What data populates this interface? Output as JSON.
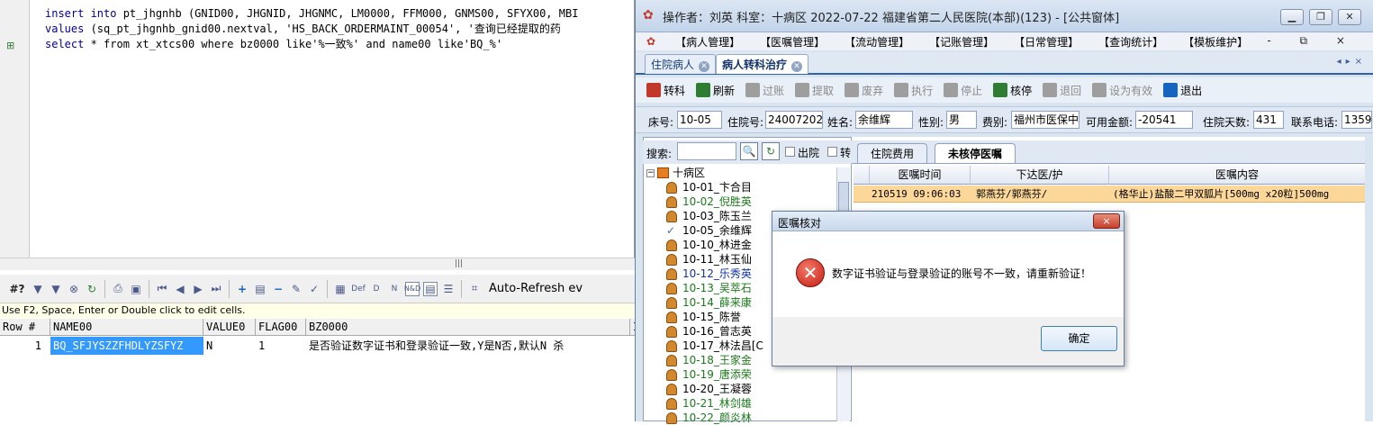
{
  "sql_editor": {
    "lines": [
      {
        "kw1": "insert into",
        "rest": " pt_jhgnhb (GNID00, JHGNID, JHGNMC, LM0000, FFM000, GNMS00, SFYX00, MBI"
      },
      {
        "kw1": "values",
        "rest": " (sq_pt_jhgnhb_gnid00.nextval, 'HS_BACK_ORDERMAINT_00054', '查询已经提取的药"
      },
      {
        "kw1": "select",
        "rest": " * from xt_xtcs00 where bz0000 like'%一致%' and name00 like'BQ_%'"
      }
    ]
  },
  "grid": {
    "auto_refresh": "Auto-Refresh ev",
    "hint": "Use F2, Space, Enter or Double click to edit cells.",
    "headers": [
      "Row #",
      "NAME00",
      "VALUE0",
      "FLAG00",
      "BZ0000",
      "I"
    ],
    "row": {
      "num": "1",
      "name00": "BQ_SFJYSZZFHDLYZSFYZ",
      "value0": "N",
      "flag00": "1",
      "bz0000": "是否验证数字证书和登录验证一致,Y是N否,默认N 杀"
    }
  },
  "app": {
    "title": "操作者：刘英  科室：十病区  2022-07-22  福建省第二人民医院(本部)(123) - [公共窗体]",
    "menus": [
      "【病人管理】",
      "【医嘱管理】",
      "【流动管理】",
      "【记账管理】",
      "【日常管理】",
      "【查询统计】",
      "【模板维护】"
    ],
    "menu_icons": "- ⧉ ×",
    "tabs": [
      "住院病人",
      "病人转科治疗"
    ],
    "actions": [
      {
        "label": "转科",
        "icon": "transfer-icon",
        "color": "#c0392b",
        "enabled": true
      },
      {
        "label": "刷新",
        "icon": "refresh-icon",
        "color": "#2e7d32",
        "enabled": true
      },
      {
        "label": "过账",
        "icon": "post-icon",
        "color": "#9e9e9e",
        "enabled": false
      },
      {
        "label": "提取",
        "icon": "extract-icon",
        "color": "#9e9e9e",
        "enabled": false
      },
      {
        "label": "废弃",
        "icon": "trash-icon",
        "color": "#9e9e9e",
        "enabled": false
      },
      {
        "label": "执行",
        "icon": "execute-icon",
        "color": "#9e9e9e",
        "enabled": false
      },
      {
        "label": "停止",
        "icon": "stop-icon",
        "color": "#9e9e9e",
        "enabled": false
      },
      {
        "label": "核停",
        "icon": "verify-stop-icon",
        "color": "#2e7d32",
        "enabled": true
      },
      {
        "label": "退回",
        "icon": "return-icon",
        "color": "#9e9e9e",
        "enabled": false
      },
      {
        "label": "设为有效",
        "icon": "set-valid-icon",
        "color": "#9e9e9e",
        "enabled": false
      },
      {
        "label": "退出",
        "icon": "exit-icon",
        "color": "#1565c0",
        "enabled": true
      }
    ],
    "info": {
      "bed_label": "床号:",
      "bed": "10-05",
      "admit_label": "住院号:",
      "admit": "24007202",
      "name_label": "姓名:",
      "name": "余维辉",
      "sex_label": "性别:",
      "sex": "男",
      "fee_label": "费别:",
      "fee": "福州市医保中",
      "balance_label": "可用金额:",
      "balance": "-20541",
      "days_label": "住院天数:",
      "days": "431",
      "phone_label": "联系电话:",
      "phone": "1359"
    },
    "search_label": "搜索:",
    "discharge_label": "出院",
    "transfer_label": "转",
    "subtabs": [
      "住院费用",
      "未核停医嘱"
    ],
    "order_headers": [
      "医嘱时间",
      "下达医/护",
      "医嘱内容"
    ],
    "order_row": {
      "time": "210519 09:06:03",
      "doctor": "郭燕芬/郭燕芬/",
      "content": "(格华止)盐酸二甲双胍片[500mg x20粒]500mg"
    },
    "tree": {
      "root": "十病区",
      "patients": [
        {
          "label": "10-01_卞合目",
          "style": "normal"
        },
        {
          "label": "10-02_倪胜英",
          "style": "green"
        },
        {
          "label": "10-03_陈玉兰",
          "style": "normal"
        },
        {
          "label": "10-05_余维辉",
          "style": "check"
        },
        {
          "label": "10-10_林进金",
          "style": "normal"
        },
        {
          "label": "10-11_林玉仙",
          "style": "normal"
        },
        {
          "label": "10-12_乐秀英",
          "style": "blue"
        },
        {
          "label": "10-13_吴萃石",
          "style": "green"
        },
        {
          "label": "10-14_薛来康",
          "style": "green"
        },
        {
          "label": "10-15_陈誉",
          "style": "normal"
        },
        {
          "label": "10-16_曾志英",
          "style": "normal"
        },
        {
          "label": "10-17_林法昌[C",
          "style": "normal"
        },
        {
          "label": "10-18_王家金",
          "style": "green"
        },
        {
          "label": "10-19_唐添荣",
          "style": "green"
        },
        {
          "label": "10-20_王凝蓉",
          "style": "normal"
        },
        {
          "label": "10-21_林剑雄",
          "style": "green"
        },
        {
          "label": "10-22_颜炎林",
          "style": "green"
        }
      ]
    }
  },
  "dialog": {
    "title": "医嘱核对",
    "message": "数字证书验证与登录验证的账号不一致，请重新验证！",
    "ok_label": "确定",
    "close_label": "×"
  }
}
